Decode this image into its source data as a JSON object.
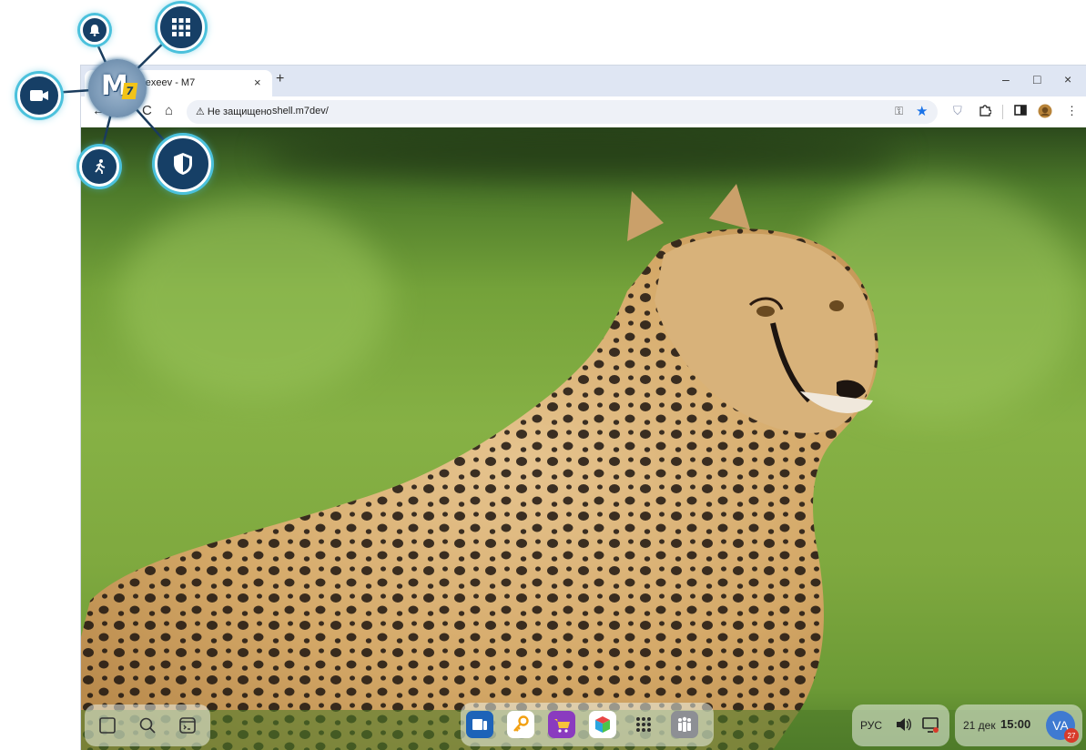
{
  "browser": {
    "tab_title": "Alexeev - M7",
    "tab_close": "×",
    "new_tab": "+",
    "window_controls": {
      "minimize": "–",
      "maximize": "□",
      "close": "×"
    },
    "nav": {
      "back": "←",
      "reload": "C",
      "home": "⌂"
    },
    "security_warning": "Не защищено",
    "url": "shell.m7dev/"
  },
  "dock": {
    "apps": [
      {
        "name": "phone-app",
        "color": "#1d63b8"
      },
      {
        "name": "keys-app",
        "color": "#ffffff"
      },
      {
        "name": "shop-app",
        "color": "#8a3bbf"
      },
      {
        "name": "cube-app",
        "color": "#ffffff"
      },
      {
        "name": "apps-grid",
        "color": "#3a3a3a"
      },
      {
        "name": "people-app",
        "color": "#8d8f94"
      }
    ]
  },
  "tray": {
    "language": "РУС",
    "date": "21 дек",
    "time": "15:00",
    "avatar_initials": "VA",
    "notification_count": "27"
  },
  "m7_menu": {
    "logo": "M",
    "logo_badge": "7",
    "accent_color": "#4bc1dc"
  },
  "colors": {
    "tabbar": "#dfe6f3",
    "orb_fill": "#163f66",
    "orb_glow": "#4bc1dc"
  }
}
